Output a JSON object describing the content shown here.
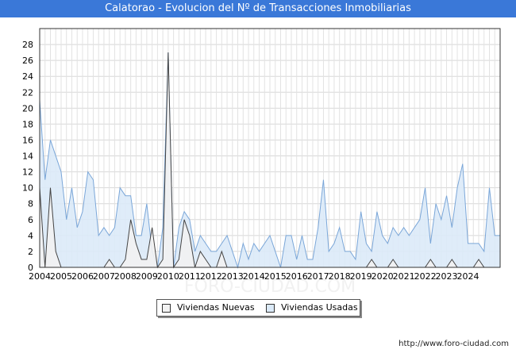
{
  "page": {
    "title": "Calatorao - Evolucion del Nº de Transacciones Inmobiliarias",
    "footer_url": "http://www.foro-ciudad.com",
    "watermark": "FORO-CIUDAD.COM"
  },
  "chart_data": {
    "type": "area",
    "title": "Calatorao - Evolucion del Nº de Transacciones Inmobiliarias",
    "xlabel": "",
    "ylabel": "",
    "ylim": [
      0,
      30
    ],
    "y_ticks": [
      0,
      2,
      4,
      6,
      8,
      10,
      12,
      14,
      16,
      18,
      20,
      22,
      24,
      26,
      28
    ],
    "x_tick_labels": [
      "2004",
      "2005",
      "2006",
      "2007",
      "2008",
      "2009",
      "2010",
      "2011",
      "2012",
      "2013",
      "2014",
      "2015",
      "2016",
      "2017",
      "2018",
      "2019",
      "2020",
      "2021",
      "2022",
      "2023",
      "2024"
    ],
    "x_start": 2004,
    "points_per_year": 4,
    "grid": true,
    "legend_position": "bottom-center",
    "series": [
      {
        "name": "Viviendas Nuevas",
        "color": "#f2f2f2",
        "line_color": "#444444",
        "values": [
          10,
          0,
          10,
          2,
          0,
          0,
          0,
          0,
          0,
          0,
          0,
          0,
          0,
          1,
          0,
          0,
          1,
          6,
          3,
          1,
          1,
          5,
          0,
          1,
          27,
          0,
          1,
          6,
          4,
          0,
          2,
          1,
          0,
          0,
          2,
          0,
          0,
          0,
          0,
          0,
          0,
          0,
          0,
          0,
          0,
          0,
          0,
          0,
          0,
          0,
          0,
          0,
          0,
          0,
          0,
          0,
          0,
          0,
          0,
          0,
          0,
          0,
          1,
          0,
          0,
          0,
          1,
          0,
          0,
          0,
          0,
          0,
          0,
          1,
          0,
          0,
          0,
          1,
          0,
          0,
          0,
          0,
          1,
          0,
          0,
          0,
          0
        ]
      },
      {
        "name": "Viviendas Usadas",
        "color": "#dbeaf8",
        "line_color": "#7aa6d8",
        "values": [
          21,
          11,
          16,
          14,
          12,
          6,
          10,
          5,
          7,
          12,
          11,
          4,
          5,
          4,
          5,
          10,
          9,
          9,
          4,
          4,
          8,
          2,
          0,
          5,
          27,
          0,
          5,
          7,
          6,
          2,
          4,
          3,
          2,
          2,
          3,
          4,
          2,
          0,
          3,
          1,
          3,
          2,
          3,
          4,
          2,
          0,
          4,
          4,
          1,
          4,
          1,
          1,
          5,
          11,
          2,
          3,
          5,
          2,
          2,
          1,
          7,
          3,
          2,
          7,
          4,
          3,
          5,
          4,
          5,
          4,
          5,
          6,
          10,
          3,
          8,
          6,
          9,
          5,
          10,
          13,
          3,
          3,
          3,
          2,
          10,
          4,
          4
        ]
      }
    ]
  }
}
